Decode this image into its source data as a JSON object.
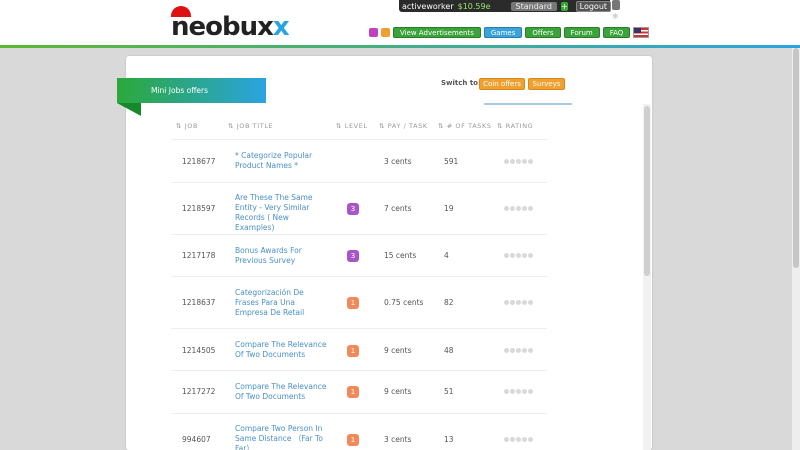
{
  "header": {
    "logo_main": "neobux",
    "logo_x": "x",
    "username": "activeworker",
    "balance": "$10.59e",
    "account_type": "Standard",
    "plus": "+",
    "logout": "Logout"
  },
  "nav": {
    "items": [
      "View Advertisements",
      "Games",
      "Offers",
      "Forum",
      "FAQ"
    ]
  },
  "page": {
    "ribbon": "Mini Jobs offers",
    "switch_label": "Switch to:",
    "switch_buttons": [
      "Coin offers",
      "Surveys"
    ]
  },
  "table": {
    "headers": [
      "JOB",
      "JOB TITLE",
      "LEVEL",
      "PAY / TASK",
      "# OF TASKS",
      "RATING"
    ],
    "rows": [
      {
        "job": "1218677",
        "title": "* Categorize Popular Product Names *",
        "level": "",
        "pay": "3 cents",
        "tasks": "591"
      },
      {
        "job": "1218597",
        "title": "Are These The Same Entity - Very Similar Records ( New Examples)",
        "level": "3",
        "pay": "7 cents",
        "tasks": "19"
      },
      {
        "job": "1217178",
        "title": "Bonus Awards For Previous Survey",
        "level": "3",
        "pay": "15 cents",
        "tasks": "4"
      },
      {
        "job": "1218637",
        "title": "Categorización De Frases Para Una Empresa De Retail",
        "level": "1",
        "pay": "0.75 cents",
        "tasks": "82"
      },
      {
        "job": "1214505",
        "title": "Compare The Relevance Of Two Documents",
        "level": "1",
        "pay": "9 cents",
        "tasks": "48"
      },
      {
        "job": "1217272",
        "title": "Compare The Relevance Of Two Documents",
        "level": "1",
        "pay": "9 cents",
        "tasks": "51"
      },
      {
        "job": "994607",
        "title": "Compare Two Person In Same Distance （Far To Far）",
        "level": "1",
        "pay": "3 cents",
        "tasks": "13"
      }
    ]
  },
  "colors": {
    "green": "#3aa33a",
    "blue": "#2aa4e0",
    "orange": "#f0a030",
    "purple": "#a855c8",
    "salmon": "#f08a5a"
  }
}
